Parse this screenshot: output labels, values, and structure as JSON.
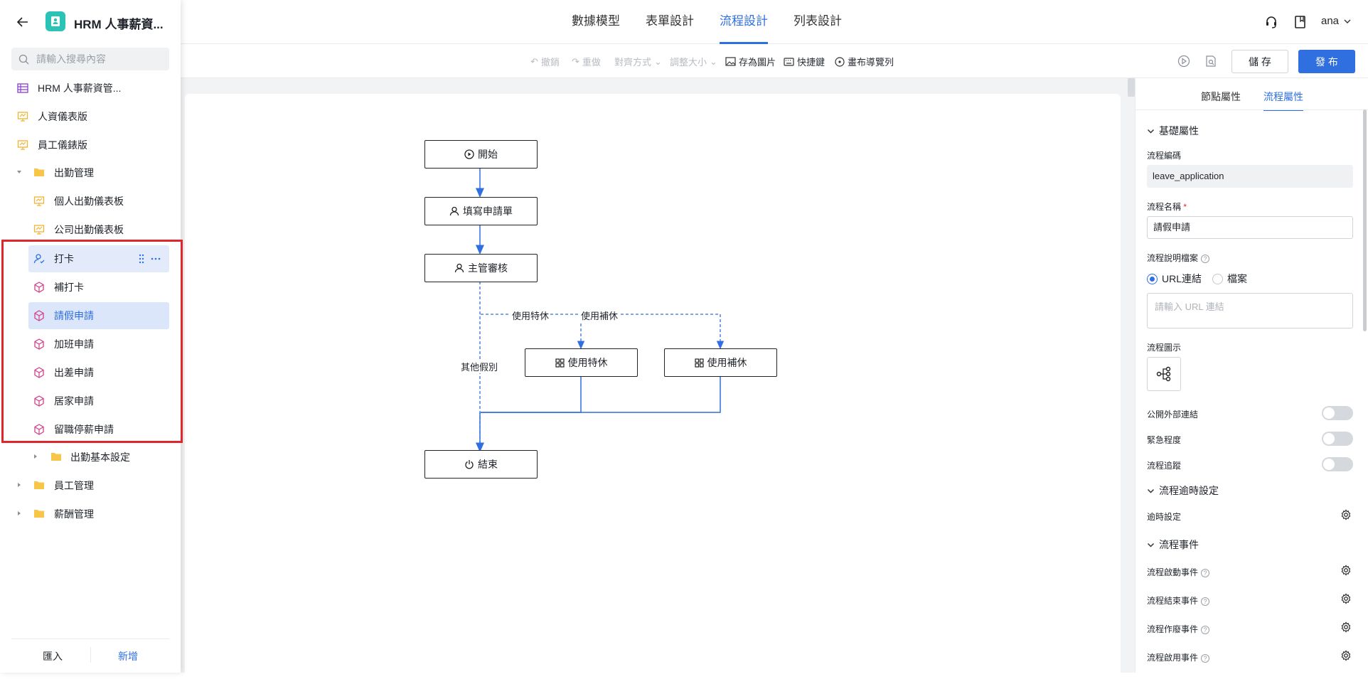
{
  "app": {
    "title": "HRM 人事薪資..."
  },
  "top_tabs": [
    "數據模型",
    "表單設計",
    "流程設計",
    "列表設計"
  ],
  "active_tab": "流程設計",
  "user": {
    "name": "ana"
  },
  "toolbar": {
    "undo": "撤銷",
    "redo": "重做",
    "align": "對齊方式",
    "resize": "調整大小",
    "save_image": "存為圖片",
    "shortcuts": "快捷鍵",
    "navigator": "畫布導覽列",
    "save": "儲 存",
    "publish": "發 布"
  },
  "sidebar": {
    "search_placeholder": "請輸入搜尋內容",
    "items": [
      {
        "label": "HRM 人事薪資管...",
        "icon": "table-icon"
      },
      {
        "label": "人資儀表版",
        "icon": "dashboard-icon"
      },
      {
        "label": "員工儀錶版",
        "icon": "dashboard-icon"
      },
      {
        "label": "出勤管理",
        "icon": "folder-icon"
      },
      {
        "label": "個人出勤儀表板",
        "icon": "dashboard-icon"
      },
      {
        "label": "公司出勤儀表板",
        "icon": "dashboard-icon"
      },
      {
        "label": "打卡",
        "icon": "user-form-icon"
      },
      {
        "label": "補打卡",
        "icon": "cube-icon"
      },
      {
        "label": "請假申請",
        "icon": "cube-icon"
      },
      {
        "label": "加班申請",
        "icon": "cube-icon"
      },
      {
        "label": "出差申請",
        "icon": "cube-icon"
      },
      {
        "label": "居家申請",
        "icon": "cube-icon"
      },
      {
        "label": "留職停薪申請",
        "icon": "cube-icon"
      },
      {
        "label": "出勤基本設定",
        "icon": "folder-icon"
      },
      {
        "label": "員工管理",
        "icon": "folder-icon"
      },
      {
        "label": "薪酬管理",
        "icon": "folder-icon"
      }
    ],
    "import_label": "匯入",
    "add_label": "新增"
  },
  "flow": {
    "nodes": {
      "start": "開始",
      "fill": "填寫申請單",
      "approve": "主管審核",
      "special": "使用特休",
      "comp": "使用補休",
      "end": "結束"
    },
    "edges": {
      "special": "使用特休",
      "comp": "使用補休",
      "other": "其他假別"
    }
  },
  "panel": {
    "tabs": [
      "節點屬性",
      "流程屬性"
    ],
    "active_tab": "流程屬性",
    "basic_section": "基礎屬性",
    "code_label": "流程編碼",
    "code_value": "leave_application",
    "name_label": "流程名稱",
    "name_value": "請假申請",
    "doc_label": "流程說明檔案",
    "radio_url": "URL連結",
    "radio_file": "檔案",
    "url_placeholder": "請輸入 URL 連結",
    "icon_label": "流程圖示",
    "toggles": [
      "公開外部連結",
      "緊急程度",
      "流程追蹤"
    ],
    "timeout_section": "流程逾時設定",
    "timeout_setting": "逾時設定",
    "events_section": "流程事件",
    "events": [
      "流程啟動事件",
      "流程結束事件",
      "流程作廢事件",
      "流程啟用事件"
    ]
  },
  "colors": {
    "accent": "#2f6fe0",
    "highlight": "#dbe6fb",
    "annotation": "#e0262b"
  }
}
